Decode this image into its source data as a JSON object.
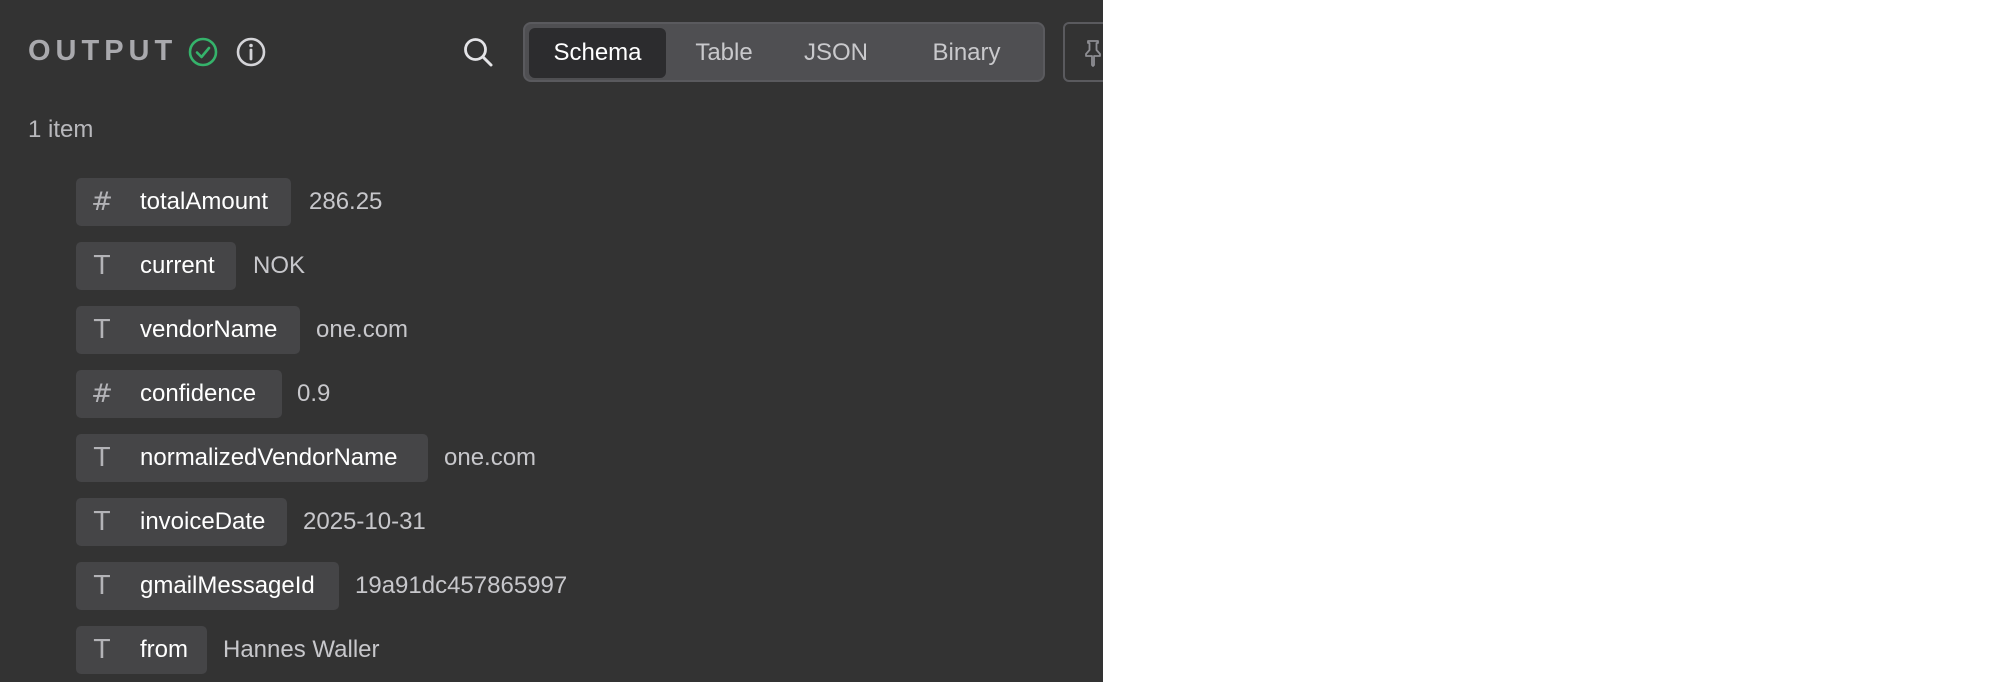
{
  "header": {
    "title": "OUTPUT",
    "status_color": "#35b36b",
    "search_icon": "search-icon",
    "pin_icon": "pin-icon"
  },
  "tabs": [
    {
      "label": "Schema",
      "active": true
    },
    {
      "label": "Table",
      "active": false
    },
    {
      "label": "JSON",
      "active": false
    },
    {
      "label": "Binary",
      "active": false
    }
  ],
  "item_count": "1 item",
  "fields": [
    {
      "type": "number",
      "type_icon": "#",
      "key": "totalAmount",
      "value": "286.25"
    },
    {
      "type": "string",
      "type_icon": "T",
      "key": "current",
      "value": "NOK"
    },
    {
      "type": "string",
      "type_icon": "T",
      "key": "vendorName",
      "value": "one.com"
    },
    {
      "type": "number",
      "type_icon": "#",
      "key": "confidence",
      "value": "0.9"
    },
    {
      "type": "string",
      "type_icon": "T",
      "key": "normalizedVendorName",
      "value": "one.com"
    },
    {
      "type": "string",
      "type_icon": "T",
      "key": "invoiceDate",
      "value": "2025-10-31"
    },
    {
      "type": "string",
      "type_icon": "T",
      "key": "gmailMessageId",
      "value": "19a91dc457865997"
    },
    {
      "type": "string",
      "type_icon": "T",
      "key": "from",
      "value": "Hannes Waller"
    }
  ]
}
